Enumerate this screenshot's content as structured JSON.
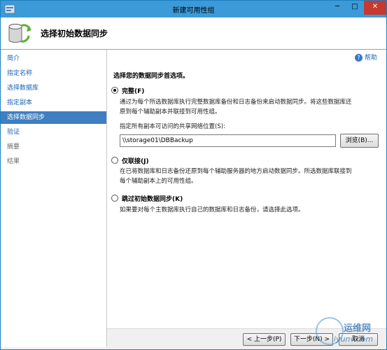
{
  "window": {
    "title": "新建可用性组",
    "minimize": "─",
    "maximize": "□",
    "close": "✕"
  },
  "header": {
    "title": "选择初始数据同步",
    "icon": "database-sync-icon"
  },
  "nav": {
    "items": [
      {
        "label": "简介",
        "state": "link"
      },
      {
        "label": "指定名称",
        "state": "link"
      },
      {
        "label": "选择数据库",
        "state": "link"
      },
      {
        "label": "指定副本",
        "state": "link"
      },
      {
        "label": "选择数据同步",
        "state": "selected"
      },
      {
        "label": "验证",
        "state": "link"
      },
      {
        "label": "摘要",
        "state": "disabled"
      },
      {
        "label": "结果",
        "state": "disabled"
      }
    ]
  },
  "help": {
    "label": "帮助",
    "icon": "question-icon"
  },
  "main": {
    "instruction": "选择您的数据同步首选项。",
    "options": [
      {
        "label": "完整(F)",
        "selected": true,
        "description_lines": [
          "通过为每个所选数据库执行完整数据库备份和日志备份来启动数据同步。将这些数据库还",
          "原到每个辅助副本并联接到可用性组。"
        ]
      },
      {
        "label": "仅联接(J)",
        "selected": false,
        "description_lines": [
          "在已将数据库和日志备份还原到每个辅助服务器的地方启动数据同步。所选数据库联接到",
          "每个辅助副本上的可用性组。"
        ]
      },
      {
        "label": "跳过初始数据同步(K)",
        "selected": false,
        "description_lines": [
          "如果要对每个主数据库执行自己的数据库和日志备份，请选择此选项。"
        ]
      }
    ],
    "share_label": "指定所有副本可访问的共享网络位置(S):",
    "share_value": "\\\\storage01\\DBBackup",
    "browse_label": "浏览(B)..."
  },
  "footer": {
    "prev": "< 上一步(P)",
    "next": "下一步(N) >",
    "cancel": "取消"
  },
  "watermark": {
    "line1": "运维网",
    "line2": "iyunv.com"
  },
  "colors": {
    "titlebar": "#3c9ad8",
    "selected_nav": "#3f7fc1",
    "link": "#1a63b5",
    "close": "#c7382f"
  }
}
